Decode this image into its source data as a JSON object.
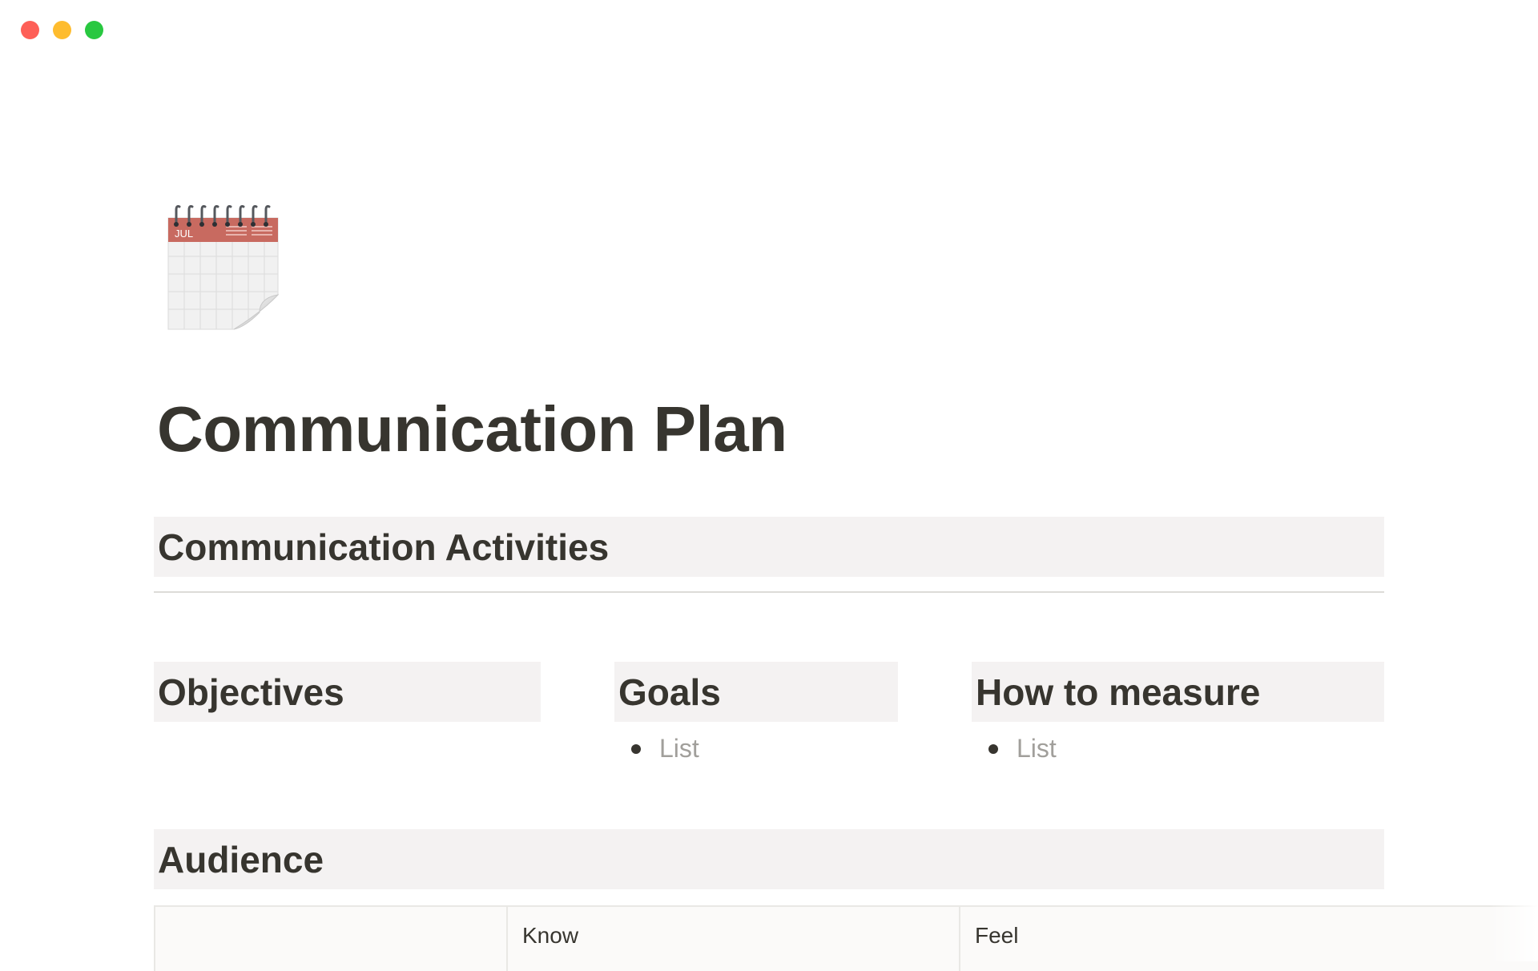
{
  "window": {
    "controls": [
      "close",
      "minimize",
      "zoom"
    ]
  },
  "page": {
    "icon": "spiral-calendar-icon",
    "icon_month": "JUL",
    "title": "Communication Plan"
  },
  "sections": {
    "activities_heading": "Communication Activities",
    "objectives_heading": "Objectives",
    "goals_heading": "Goals",
    "goals_items": [
      "List"
    ],
    "measure_heading": "How to measure",
    "measure_items": [
      "List"
    ],
    "audience_heading": "Audience"
  },
  "audience_table": {
    "columns": [
      "",
      "Know",
      "Feel"
    ]
  },
  "colors": {
    "heading_background": "#f4f2f2",
    "text": "#37352f",
    "placeholder_text": "#a19f9b",
    "calendar_header": "#c86a60"
  }
}
